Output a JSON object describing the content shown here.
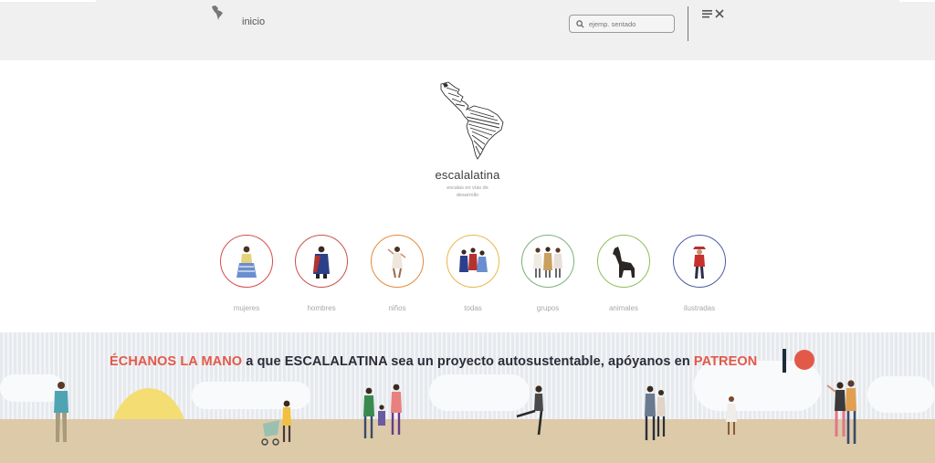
{
  "header": {
    "home_label": "inicio",
    "search_placeholder": "ejemp. sentado",
    "menu_icon": "menu-close-icon"
  },
  "logo": {
    "title": "escalalatina",
    "subtitle": "escalas en vías de desarrollo"
  },
  "categories": [
    {
      "label": "mujeres",
      "ring_color": "#d94a4a"
    },
    {
      "label": "hombres",
      "ring_color": "#c9504a"
    },
    {
      "label": "niños",
      "ring_color": "#e38a3a"
    },
    {
      "label": "todas",
      "ring_color": "#e8b84a"
    },
    {
      "label": "grupos",
      "ring_color": "#7bb07a"
    },
    {
      "label": "animales",
      "ring_color": "#8fbf5a"
    },
    {
      "label": "ilustradas",
      "ring_color": "#4a5aa8"
    }
  ],
  "banner": {
    "highlight": "ÉCHANOS LA MANO",
    "part1": " a que ESCALALATINA sea un proyecto autosustentable, apóyanos en ",
    "link": "PATREON",
    "accent_color": "#e2594a"
  }
}
